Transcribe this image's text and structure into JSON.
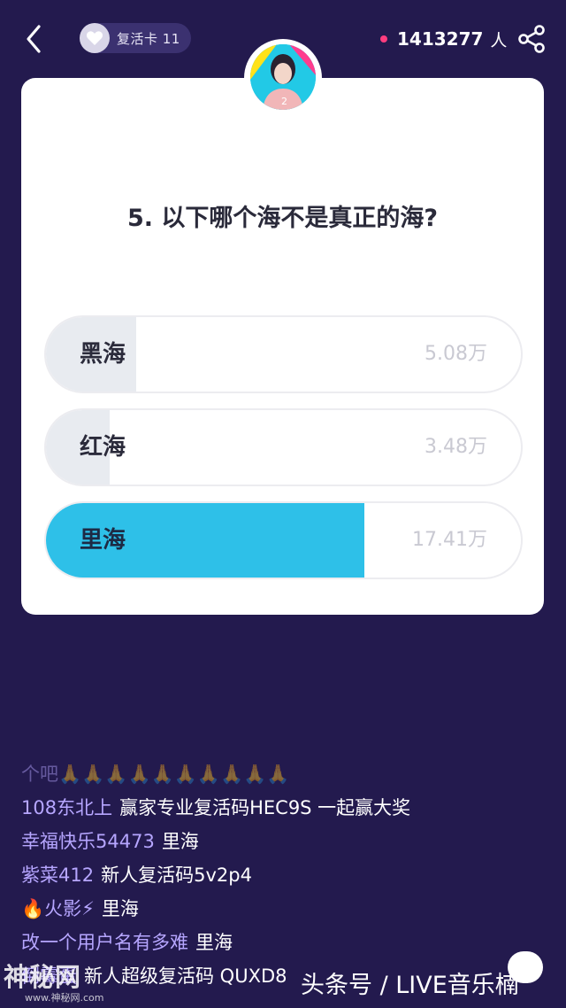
{
  "header": {
    "revive_card_label": "复活卡 11",
    "viewer_count": "1413277",
    "viewer_unit": "人"
  },
  "question": "5. 以下哪个海不是真正的海?",
  "options": [
    {
      "label": "黑海",
      "count": "5.08万",
      "fill_fraction": 0.19,
      "correct": false
    },
    {
      "label": "红海",
      "count": "3.48万",
      "fill_fraction": 0.135,
      "correct": false
    },
    {
      "label": "里海",
      "count": "17.41万",
      "fill_fraction": 0.67,
      "correct": true
    }
  ],
  "colors": {
    "background": "#231a4e",
    "correct_fill": "#2ec0e8",
    "option_fill": "#e8ebf0",
    "username": "#b6a6ff",
    "viewer_dot": "#ff3d7f"
  },
  "chat": [
    {
      "user": "个吧🙏🙏🙏🙏🙏🙏🙏🙏🙏🙏",
      "msg": ""
    },
    {
      "user": "108东北上",
      "msg": "赢家专业复活码HEC9S  一起赢大奖"
    },
    {
      "user": "幸福快乐54473",
      "msg": "里海"
    },
    {
      "user": "紫菜412",
      "msg": "新人复活码5v2p4"
    },
    {
      "user": "🔥火影⚡",
      "msg": "里海"
    },
    {
      "user": "改一个用户名有多难",
      "msg": "里海"
    },
    {
      "user": "倒霉蛋",
      "msg": "新人超级复活码    QUXD8"
    }
  ],
  "watermarks": {
    "left": "神秘网",
    "left_sub": "www.神秘网.com",
    "right": "头条号 / LIVE音乐楠"
  },
  "icons": {
    "back": "back-arrow-icon",
    "heart": "heart-icon",
    "share": "share-icon",
    "chat": "chat-bubble-icon"
  }
}
